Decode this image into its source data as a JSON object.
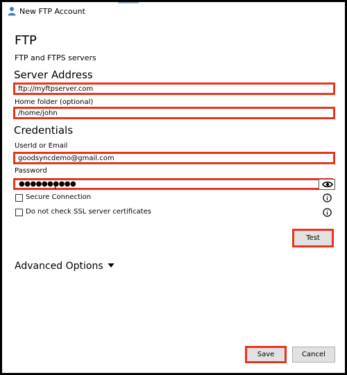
{
  "window": {
    "title": "New FTP Account",
    "icon": "user-icon"
  },
  "header": {
    "title": "FTP",
    "subtitle": "FTP and FTPS servers"
  },
  "server": {
    "section_title": "Server Address",
    "address_value": "ftp://myftpserver.com",
    "home_label": "Home folder (optional)",
    "home_value": "/home/john"
  },
  "credentials": {
    "section_title": "Credentials",
    "userid_label": "UserId or Email",
    "userid_value": "goodsyncdemo@gmail.com",
    "password_label": "Password",
    "password_masked": "●●●●●●●●●●"
  },
  "options": {
    "secure_label": "Secure Connection",
    "ssl_label": "Do not check SSL server certificates"
  },
  "buttons": {
    "test": "Test",
    "save": "Save",
    "cancel": "Cancel"
  },
  "advanced": {
    "label": "Advanced Options"
  },
  "colors": {
    "highlight": "#e8331f",
    "button_bg": "#e1e1e1"
  }
}
